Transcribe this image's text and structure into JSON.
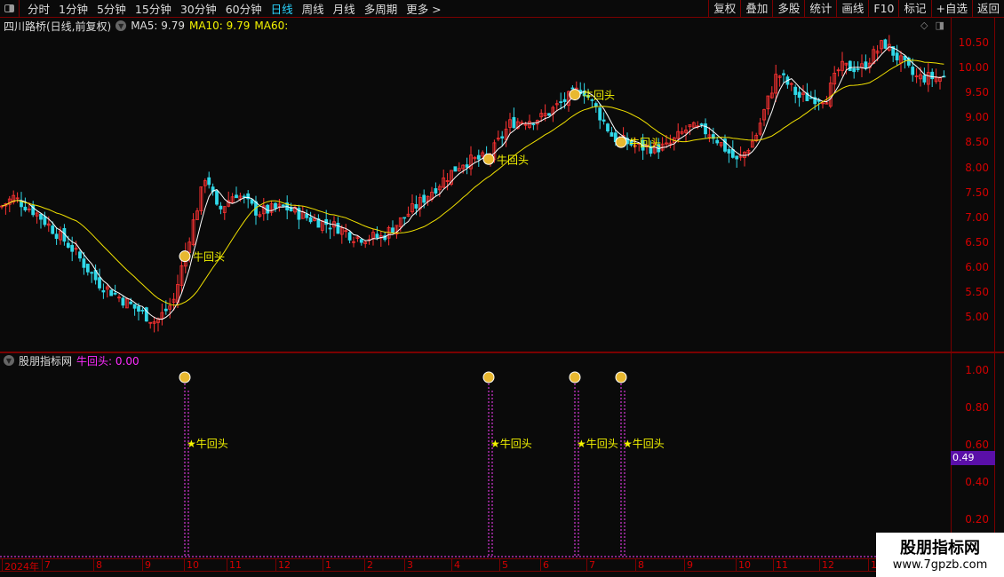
{
  "toolbar": {
    "tabs": [
      "分时",
      "1分钟",
      "5分钟",
      "15分钟",
      "30分钟",
      "60分钟",
      "日线",
      "周线",
      "月线",
      "多周期",
      "更多 >"
    ],
    "active": "日线",
    "buttons": [
      "复权",
      "叠加",
      "多股",
      "统计",
      "画线",
      "F10",
      "标记",
      "+自选",
      "返回"
    ]
  },
  "main": {
    "stock_title": "四川路桥(日线,前复权)",
    "ma5": "MA5: 9.79",
    "ma10": "MA10: 9.79",
    "ma60": "MA60:",
    "price_axis": [
      "10.50",
      "10.00",
      "9.50",
      "9.00",
      "8.50",
      "8.00",
      "7.50",
      "7.00",
      "6.50",
      "6.00",
      "5.50",
      "5.00"
    ],
    "signal_label": "牛回头"
  },
  "indicator": {
    "name": "股朋指标网",
    "series": "牛回头: 0.00",
    "axis": [
      "1.00",
      "0.80",
      "0.60",
      "0.40",
      "0.20"
    ],
    "current_value": "0.49",
    "signal_label": "★牛回头"
  },
  "xaxis": [
    "2024年",
    "7",
    "8",
    "9",
    "10",
    "11",
    "12",
    "1",
    "2",
    "3",
    "4",
    "5",
    "6",
    "7",
    "8",
    "9",
    "10",
    "11",
    "12",
    "1"
  ],
  "watermark": {
    "line1": "股朋指标网",
    "line2": "www.7gpzb.com"
  },
  "colors": {
    "up": "#ff3232",
    "down": "#30d8e8",
    "ma5": "#ffffff",
    "ma10": "#f0e000",
    "signal": "#ff40ff",
    "axis": "#d40000"
  },
  "price_path": [
    [
      0,
      7.2
    ],
    [
      15,
      7.4
    ],
    [
      40,
      7.1
    ],
    [
      80,
      6.4
    ],
    [
      110,
      5.7
    ],
    [
      150,
      5.2
    ],
    [
      175,
      4.9
    ],
    [
      195,
      5.3
    ],
    [
      210,
      6.4
    ],
    [
      228,
      7.6
    ],
    [
      232,
      7.9
    ],
    [
      245,
      7.1
    ],
    [
      265,
      7.5
    ],
    [
      290,
      7.1
    ],
    [
      320,
      7.2
    ],
    [
      345,
      7.0
    ],
    [
      380,
      6.8
    ],
    [
      400,
      6.6
    ],
    [
      430,
      6.6
    ],
    [
      455,
      7.0
    ],
    [
      490,
      7.6
    ],
    [
      520,
      8.1
    ],
    [
      550,
      8.2
    ],
    [
      575,
      8.9
    ],
    [
      610,
      9.0
    ],
    [
      640,
      9.4
    ],
    [
      655,
      9.6
    ],
    [
      670,
      9.2
    ],
    [
      690,
      8.6
    ],
    [
      720,
      8.4
    ],
    [
      750,
      8.4
    ],
    [
      775,
      8.8
    ],
    [
      800,
      8.7
    ],
    [
      830,
      8.1
    ],
    [
      850,
      8.6
    ],
    [
      875,
      9.9
    ],
    [
      900,
      9.4
    ],
    [
      930,
      9.4
    ],
    [
      945,
      10.0
    ],
    [
      970,
      10.0
    ],
    [
      995,
      10.5
    ],
    [
      1010,
      10.2
    ],
    [
      1030,
      9.8
    ],
    [
      1060,
      9.8
    ]
  ],
  "signals": [
    208,
    550,
    647,
    699
  ]
}
